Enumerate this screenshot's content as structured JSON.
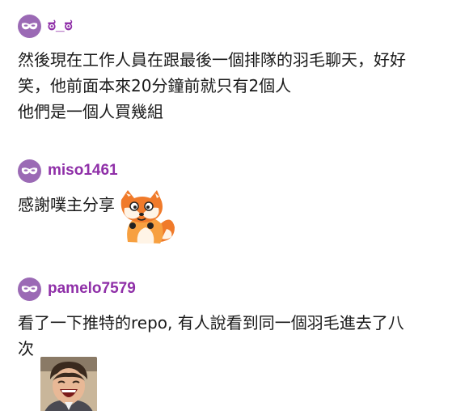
{
  "comments": [
    {
      "username": "ಠ_ಠ",
      "lines": [
        "然後現在工作人員在跟最後一個排隊的羽毛聊天，好好",
        "笑，他前面本來20分鐘前就只有2個人",
        "他們是一個人買幾組"
      ],
      "avatar_icon": "mask-icon"
    },
    {
      "username": "miso1461",
      "lines": [
        "感謝噗主分享"
      ],
      "avatar_icon": "mask-icon",
      "sticker": "fox-sticker"
    },
    {
      "username": "pamelo7579",
      "lines": [
        "看了一下推特的repo, 有人說看到同一個羽毛進去了八",
        "次"
      ],
      "avatar_icon": "mask-icon",
      "sticker": "laughing-man-sticker"
    }
  ],
  "colors": {
    "username": "#8f2fa8",
    "avatar_bg": "#9b6ab5",
    "text": "#1a1a1a"
  }
}
